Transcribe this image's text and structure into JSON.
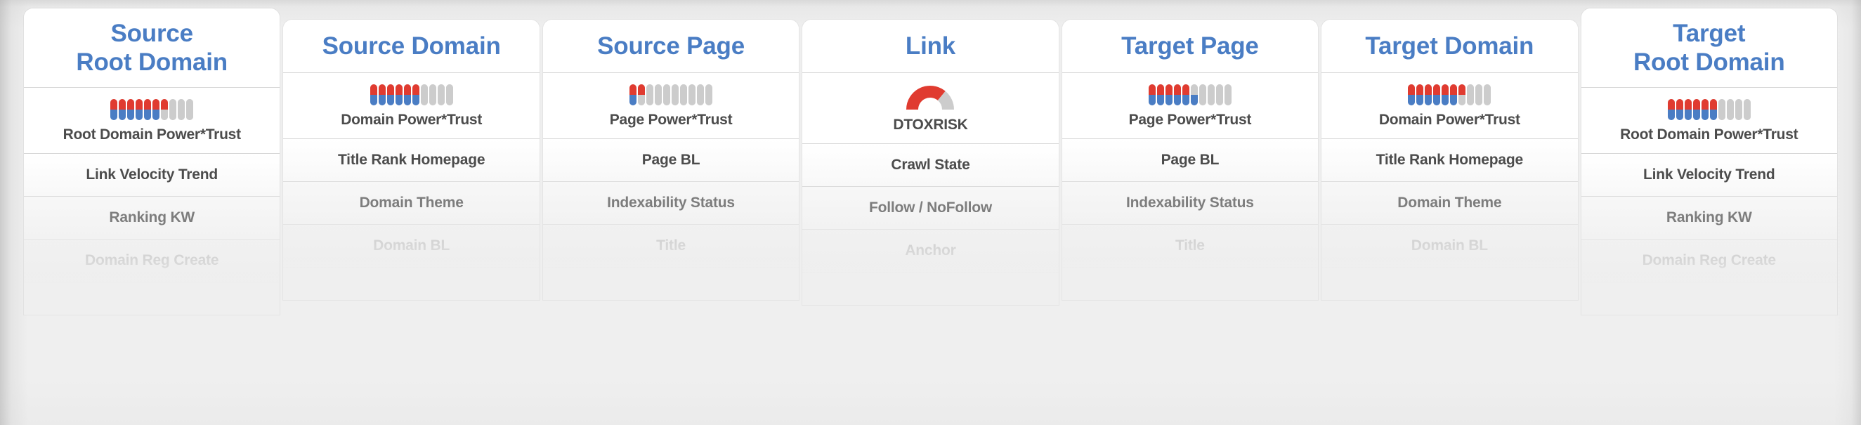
{
  "theme": {
    "header_blue": "#4a7dc4",
    "bar_red": "#e03b30",
    "bar_blue": "#4a7dc4",
    "bar_gray": "#cccccc",
    "row_text_dark": "#4c4c4c",
    "row_text_mid": "#7d7d7d",
    "row_text_light": "#c4c4c4",
    "page_background": "#eeeeee",
    "card_background": "#ffffff"
  },
  "columns": [
    {
      "header_lines": [
        "Source",
        "Root Domain"
      ],
      "metric": {
        "type": "power-trust-meter",
        "label": "Root Domain Power*Trust",
        "total_bars": 10,
        "bars": [
          {
            "top": "red",
            "bottom": "blue"
          },
          {
            "top": "red",
            "bottom": "blue"
          },
          {
            "top": "red",
            "bottom": "blue"
          },
          {
            "top": "red",
            "bottom": "blue"
          },
          {
            "top": "red",
            "bottom": "blue"
          },
          {
            "top": "red",
            "bottom": "blue"
          },
          {
            "top": "red",
            "bottom": "gray"
          },
          {
            "top": "gray",
            "bottom": "gray"
          },
          {
            "top": "gray",
            "bottom": "gray"
          },
          {
            "top": "gray",
            "bottom": "gray"
          }
        ]
      },
      "rows": [
        "Link Velocity Trend",
        "Ranking KW",
        "Domain Reg Create"
      ]
    },
    {
      "header_lines": [
        "Source Domain"
      ],
      "metric": {
        "type": "power-trust-meter",
        "label": "Domain Power*Trust",
        "total_bars": 10,
        "bars": [
          {
            "top": "red",
            "bottom": "blue"
          },
          {
            "top": "red",
            "bottom": "blue"
          },
          {
            "top": "red",
            "bottom": "blue"
          },
          {
            "top": "red",
            "bottom": "blue"
          },
          {
            "top": "red",
            "bottom": "blue"
          },
          {
            "top": "red",
            "bottom": "blue"
          },
          {
            "top": "gray",
            "bottom": "gray"
          },
          {
            "top": "gray",
            "bottom": "gray"
          },
          {
            "top": "gray",
            "bottom": "gray"
          },
          {
            "top": "gray",
            "bottom": "gray"
          }
        ]
      },
      "rows": [
        "Title Rank Homepage",
        "Domain Theme",
        "Domain BL"
      ]
    },
    {
      "header_lines": [
        "Source Page"
      ],
      "metric": {
        "type": "power-trust-meter",
        "label": "Page Power*Trust",
        "total_bars": 10,
        "bars": [
          {
            "top": "red",
            "bottom": "blue"
          },
          {
            "top": "red",
            "bottom": "gray"
          },
          {
            "top": "gray",
            "bottom": "gray"
          },
          {
            "top": "gray",
            "bottom": "gray"
          },
          {
            "top": "gray",
            "bottom": "gray"
          },
          {
            "top": "gray",
            "bottom": "gray"
          },
          {
            "top": "gray",
            "bottom": "gray"
          },
          {
            "top": "gray",
            "bottom": "gray"
          },
          {
            "top": "gray",
            "bottom": "gray"
          },
          {
            "top": "gray",
            "bottom": "gray"
          }
        ]
      },
      "rows": [
        "Page BL",
        "Indexability Status",
        "Title"
      ]
    },
    {
      "header_lines": [
        "Link"
      ],
      "metric": {
        "type": "dtoxrisk-gauge",
        "label": "DTOXRISK",
        "filled_fraction": 0.72,
        "filled_color": "#e03b30",
        "track_color": "#cccccc"
      },
      "rows": [
        "Crawl State",
        "Follow / NoFollow",
        "Anchor"
      ]
    },
    {
      "header_lines": [
        "Target Page"
      ],
      "metric": {
        "type": "power-trust-meter",
        "label": "Page Power*Trust",
        "total_bars": 10,
        "bars": [
          {
            "top": "red",
            "bottom": "blue"
          },
          {
            "top": "red",
            "bottom": "blue"
          },
          {
            "top": "red",
            "bottom": "blue"
          },
          {
            "top": "red",
            "bottom": "blue"
          },
          {
            "top": "red",
            "bottom": "blue"
          },
          {
            "top": "gray",
            "bottom": "blue"
          },
          {
            "top": "gray",
            "bottom": "gray"
          },
          {
            "top": "gray",
            "bottom": "gray"
          },
          {
            "top": "gray",
            "bottom": "gray"
          },
          {
            "top": "gray",
            "bottom": "gray"
          }
        ]
      },
      "rows": [
        "Page BL",
        "Indexability Status",
        "Title"
      ]
    },
    {
      "header_lines": [
        "Target Domain"
      ],
      "metric": {
        "type": "power-trust-meter",
        "label": "Domain Power*Trust",
        "total_bars": 10,
        "bars": [
          {
            "top": "red",
            "bottom": "blue"
          },
          {
            "top": "red",
            "bottom": "blue"
          },
          {
            "top": "red",
            "bottom": "blue"
          },
          {
            "top": "red",
            "bottom": "blue"
          },
          {
            "top": "red",
            "bottom": "blue"
          },
          {
            "top": "red",
            "bottom": "blue"
          },
          {
            "top": "red",
            "bottom": "gray"
          },
          {
            "top": "gray",
            "bottom": "gray"
          },
          {
            "top": "gray",
            "bottom": "gray"
          },
          {
            "top": "gray",
            "bottom": "gray"
          }
        ]
      },
      "rows": [
        "Title Rank Homepage",
        "Domain Theme",
        "Domain BL"
      ]
    },
    {
      "header_lines": [
        "Target",
        "Root Domain"
      ],
      "metric": {
        "type": "power-trust-meter",
        "label": "Root Domain Power*Trust",
        "total_bars": 10,
        "bars": [
          {
            "top": "red",
            "bottom": "blue"
          },
          {
            "top": "red",
            "bottom": "blue"
          },
          {
            "top": "red",
            "bottom": "blue"
          },
          {
            "top": "red",
            "bottom": "blue"
          },
          {
            "top": "red",
            "bottom": "blue"
          },
          {
            "top": "red",
            "bottom": "blue"
          },
          {
            "top": "gray",
            "bottom": "gray"
          },
          {
            "top": "gray",
            "bottom": "gray"
          },
          {
            "top": "gray",
            "bottom": "gray"
          },
          {
            "top": "gray",
            "bottom": "gray"
          }
        ]
      },
      "rows": [
        "Link Velocity Trend",
        "Ranking KW",
        "Domain Reg Create"
      ]
    }
  ]
}
